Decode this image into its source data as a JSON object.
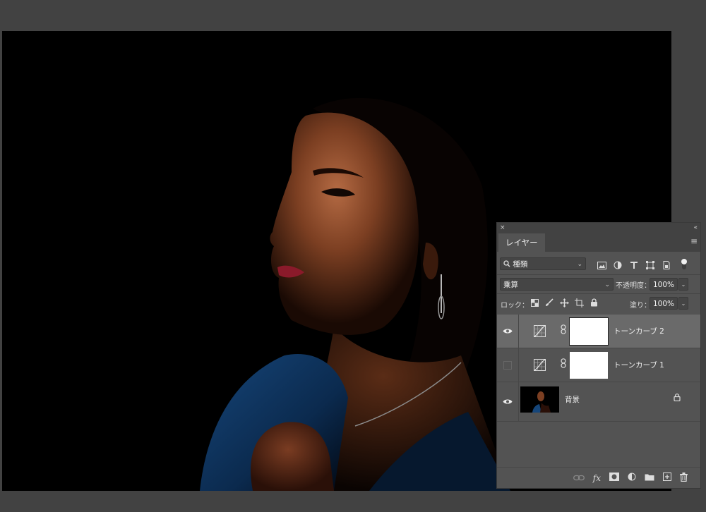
{
  "panel": {
    "close_glyph": "×",
    "collapse_glyph": "«",
    "tab_label": "レイヤー",
    "menu_glyph": "≡"
  },
  "filter": {
    "kind_label": "種類",
    "chevron": "⌄",
    "icons": [
      "image-filter-icon",
      "adjustment-filter-icon",
      "type-filter-icon",
      "shape-filter-icon",
      "smart-object-filter-icon",
      "filter-toggle-icon"
    ]
  },
  "blend": {
    "mode": "乗算",
    "opacity_label": "不透明度：",
    "opacity_value": "100%",
    "chevron": "⌄"
  },
  "lock": {
    "label": "ロック：",
    "fill_label": "塗り：",
    "fill_value": "100%",
    "icons": [
      "lock-transparent-icon",
      "lock-image-icon",
      "lock-position-icon",
      "lock-artboard-icon",
      "lock-all-icon"
    ]
  },
  "layers": [
    {
      "name": "トーンカーブ 2",
      "visible": true,
      "selected": true,
      "type": "curves"
    },
    {
      "name": "トーンカーブ 1",
      "visible": false,
      "selected": false,
      "type": "curves"
    },
    {
      "name": "背景",
      "visible": true,
      "selected": false,
      "type": "background",
      "locked": true
    }
  ],
  "bottom_icons": [
    "link-icon",
    "fx-icon",
    "add-mask-icon",
    "new-adjustment-icon",
    "new-group-icon",
    "new-layer-icon",
    "trash-icon"
  ],
  "bottom_fx_label": "fx",
  "colors": {
    "app_bg": "#424242",
    "panel_bg": "#535353",
    "selected_row": "#6a6a6a",
    "canvas_bg": "#000000"
  }
}
